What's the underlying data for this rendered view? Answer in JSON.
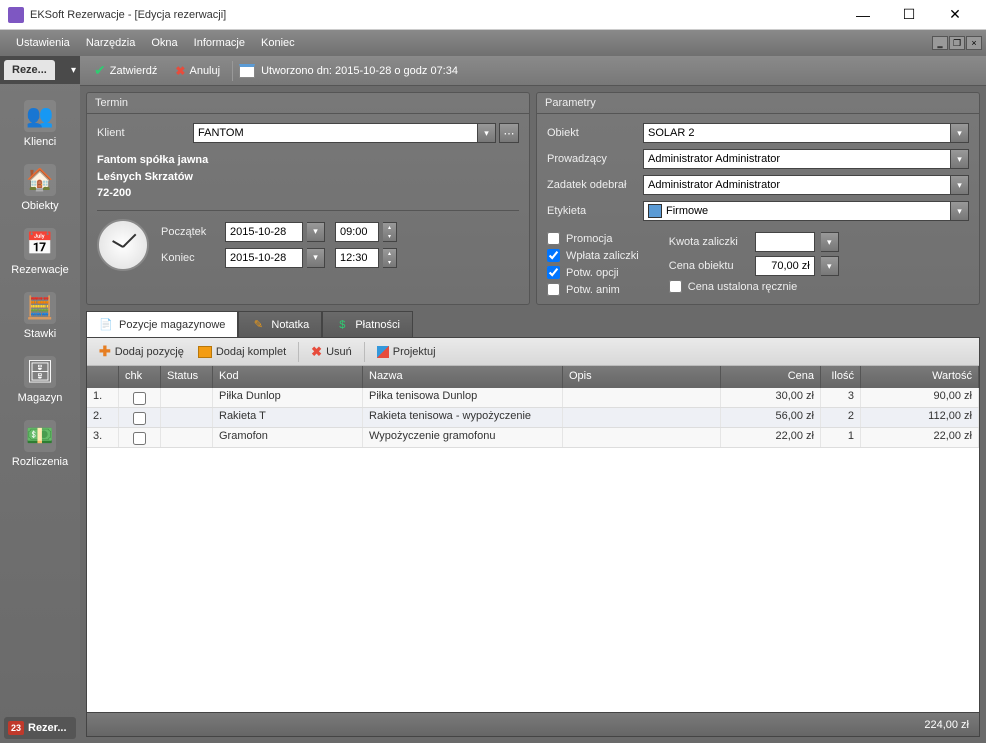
{
  "window": {
    "title": "EKSoft Rezerwacje - [Edycja rezerwacji]"
  },
  "menubar": [
    "Ustawienia",
    "Narzędzia",
    "Okna",
    "Informacje",
    "Koniec"
  ],
  "sidebar": {
    "tab": "Reze...",
    "items": [
      {
        "label": "Klienci",
        "icon": "👥"
      },
      {
        "label": "Obiekty",
        "icon": "🏠"
      },
      {
        "label": "Rezerwacje",
        "icon": "📅"
      },
      {
        "label": "Stawki",
        "icon": "🧮"
      },
      {
        "label": "Magazyn",
        "icon": "🗄"
      },
      {
        "label": "Rozliczenia",
        "icon": "💵"
      }
    ],
    "footer": "Rezer..."
  },
  "toolbar": {
    "approve": "Zatwierdź",
    "cancel": "Anuluj",
    "created": "Utworzono dn: 2015-10-28 o godz 07:34"
  },
  "termin": {
    "title": "Termin",
    "klient_label": "Klient",
    "klient_value": "FANTOM",
    "addr1": "Fantom spółka jawna",
    "addr2": "Leśnych Skrzatów",
    "addr3": "72-200",
    "poczatek_label": "Początek",
    "poczatek_date": "2015-10-28",
    "poczatek_time": "09:00",
    "koniec_label": "Koniec",
    "koniec_date": "2015-10-28",
    "koniec_time": "12:30"
  },
  "parametry": {
    "title": "Parametry",
    "obiekt_label": "Obiekt",
    "obiekt_value": "SOLAR 2",
    "prowadzacy_label": "Prowadzący",
    "prowadzacy_value": "Administrator Administrator",
    "zadatek_label": "Zadatek odebrał",
    "zadatek_value": "Administrator Administrator",
    "etykieta_label": "Etykieta",
    "etykieta_value": "Firmowe",
    "etykieta_color": "#5b9bd5",
    "promocja_label": "Promocja",
    "promocja_checked": false,
    "wplata_label": "Wpłata zaliczki",
    "wplata_checked": true,
    "potwopcji_label": "Potw. opcji",
    "potwopcji_checked": true,
    "potwanim_label": "Potw. anim",
    "potwanim_checked": false,
    "kwota_label": "Kwota zaliczki",
    "kwota_value": "",
    "cena_label": "Cena obiektu",
    "cena_value": "70,00 zł",
    "recznie_label": "Cena ustalona ręcznie",
    "recznie_checked": false
  },
  "tabs": {
    "pozycje": "Pozycje magazynowe",
    "notatka": "Notatka",
    "platnosci": "Płatności"
  },
  "tab_toolbar": {
    "dodaj": "Dodaj pozycję",
    "komplet": "Dodaj komplet",
    "usun": "Usuń",
    "projektuj": "Projektuj"
  },
  "grid": {
    "headers": {
      "chk": "chk",
      "status": "Status",
      "kod": "Kod",
      "nazwa": "Nazwa",
      "opis": "Opis",
      "cena": "Cena",
      "ilosc": "Ilość",
      "wartosc": "Wartość"
    },
    "rows": [
      {
        "n": "1.",
        "kod": "Piłka Dunlop",
        "nazwa": "Piłka tenisowa Dunlop",
        "opis": "",
        "cena": "30,00 zł",
        "ilosc": "3",
        "wartosc": "90,00 zł"
      },
      {
        "n": "2.",
        "kod": "Rakieta T",
        "nazwa": "Rakieta tenisowa - wypożyczenie",
        "opis": "",
        "cena": "56,00 zł",
        "ilosc": "2",
        "wartosc": "112,00 zł"
      },
      {
        "n": "3.",
        "kod": "Gramofon",
        "nazwa": "Wypożyczenie gramofonu",
        "opis": "",
        "cena": "22,00 zł",
        "ilosc": "1",
        "wartosc": "22,00 zł"
      }
    ],
    "total": "224,00 zł"
  }
}
